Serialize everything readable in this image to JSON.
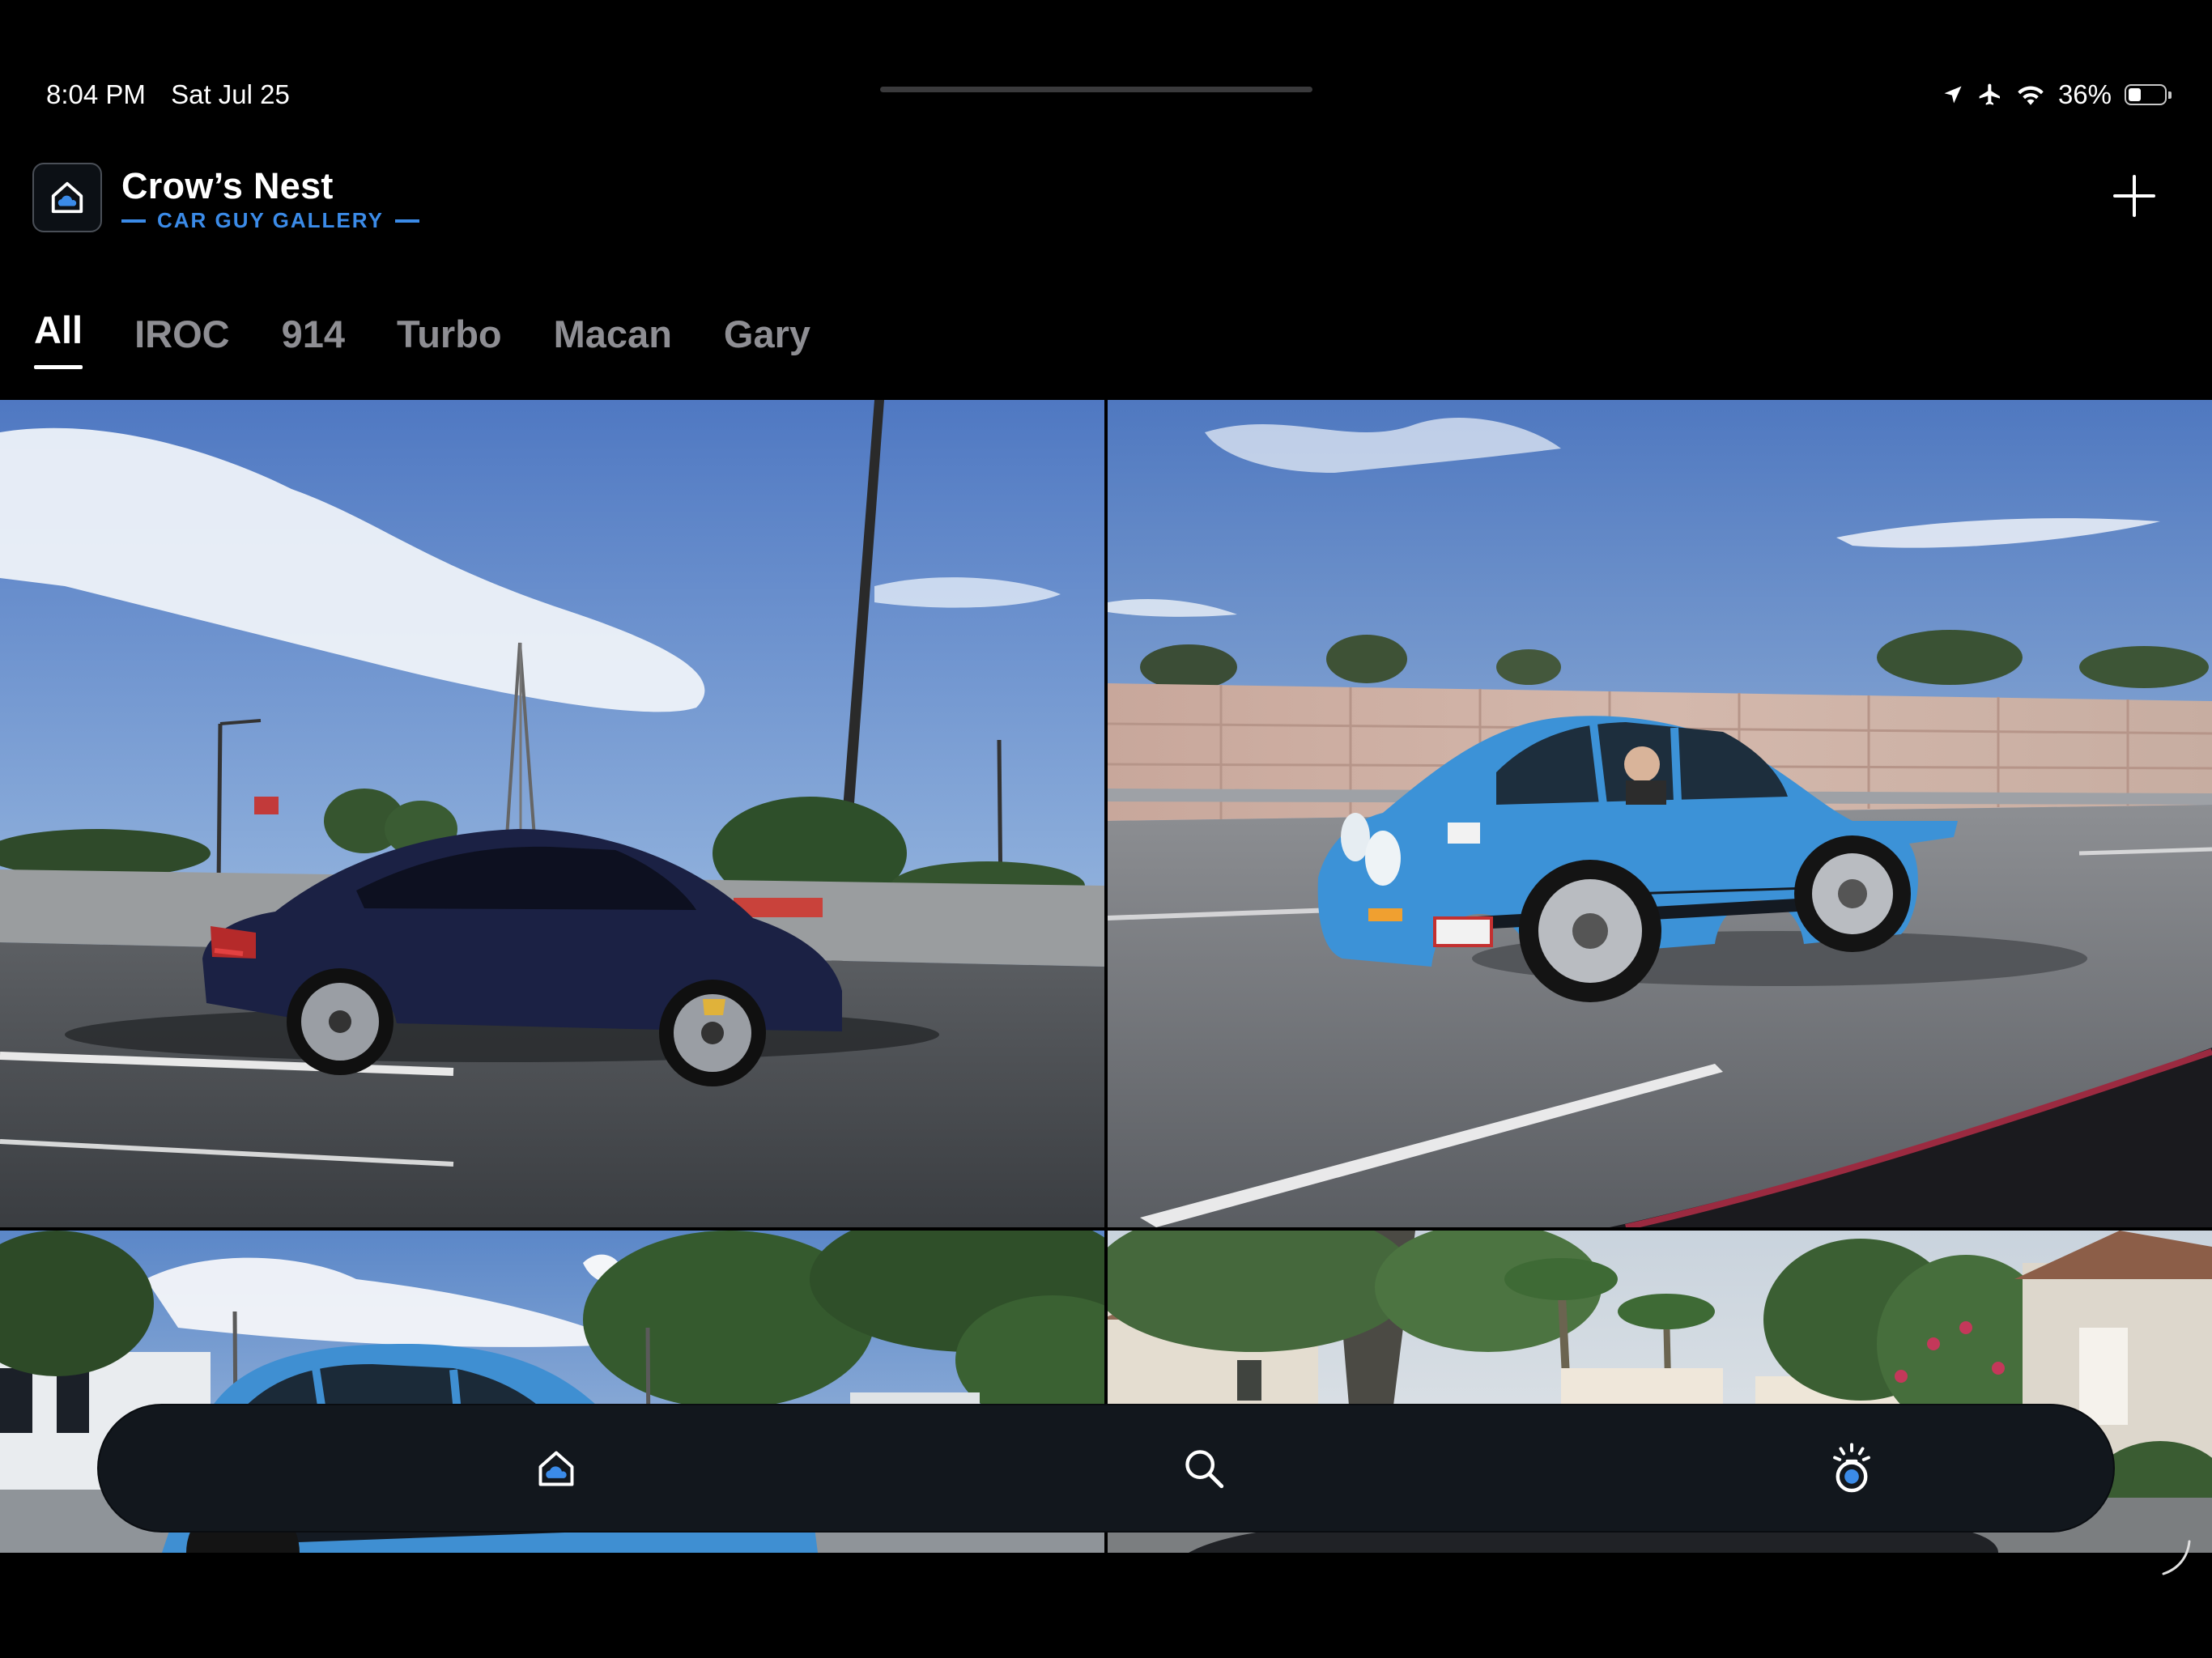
{
  "status_bar": {
    "time": "8:04 PM",
    "date": "Sat Jul 25",
    "battery_percent_label": "36%",
    "battery_level": 0.36,
    "icons": [
      "location-arrow-icon",
      "airplane-icon",
      "wifi-icon",
      "battery-icon"
    ]
  },
  "header": {
    "title": "Crow’s Nest",
    "subtitle": "CAR GUY GALLERY",
    "logo_icon": "home-cloud-icon",
    "add_icon": "plus-icon"
  },
  "tabs": [
    {
      "label": "All",
      "active": true
    },
    {
      "label": "IROC",
      "active": false
    },
    {
      "label": "914",
      "active": false
    },
    {
      "label": "Turbo",
      "active": false
    },
    {
      "label": "Macan",
      "active": false
    },
    {
      "label": "Gary",
      "active": false
    }
  ],
  "gallery": {
    "photos": [
      {
        "subject": "dark blue Porsche 911 Turbo on highway"
      },
      {
        "subject": "light blue Porsche 911 IROC on highway"
      },
      {
        "subject": "light blue Porsche parked near trees"
      },
      {
        "subject": "residential street with palm trees"
      }
    ]
  },
  "tab_bar": {
    "items": [
      "home-icon",
      "search-icon",
      "camera-spark-icon"
    ]
  },
  "colors": {
    "background": "#000000",
    "accent": "#3b8be8",
    "tab_inactive": "#8e8e93",
    "tab_bar_bg": "#12171d"
  }
}
